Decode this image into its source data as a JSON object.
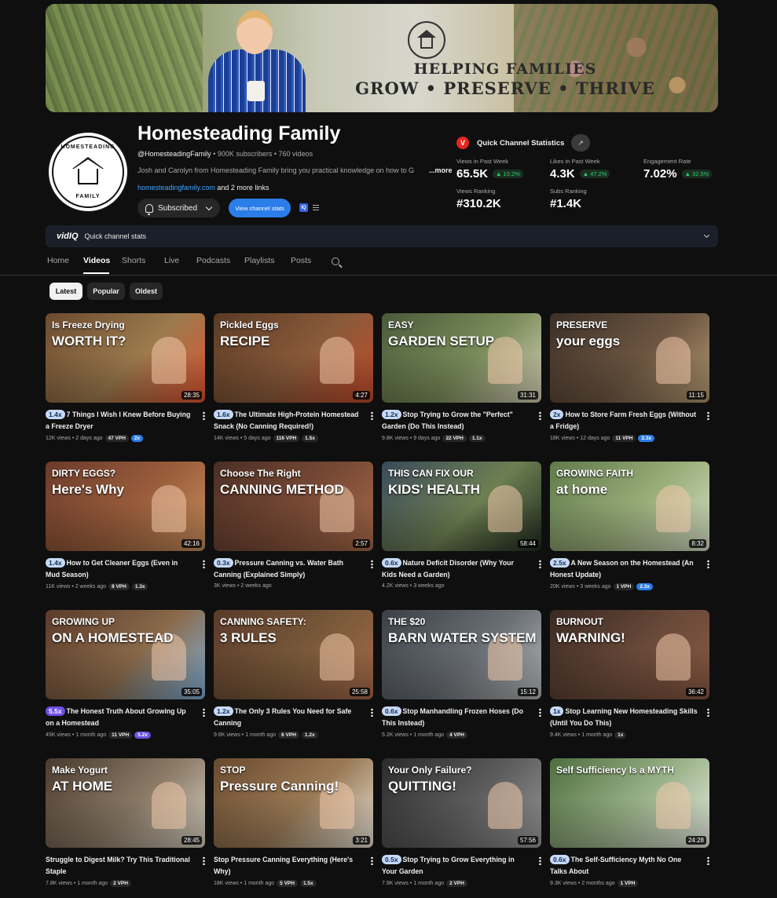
{
  "banner": {
    "tagline_line1": "HELPING FAMILIES",
    "tagline_line2": "GROW • PRESERVE • THRIVE"
  },
  "channel": {
    "name": "Homesteading Family",
    "handle": "@HomesteadingFamily",
    "subscribers": "• 900K subscribers",
    "videos": "• 760 videos",
    "description": "Josh and Carolyn from Homesteading Family bring you practical knowledge on how to G",
    "more_label": "...more",
    "link": "homesteadingfamily.com",
    "more_links": "and 2 more links",
    "subscribed_label": "Subscribed",
    "view_stats_label": "View channel stats",
    "avatar_top": "HOMESTEADING",
    "avatar_bottom": "FAMILY"
  },
  "stats": {
    "title": "Quick Channel Statistics",
    "logo": "V",
    "views_week_label": "Views in Past Week",
    "views_week_value": "65.5K",
    "views_week_change": "▲ 10.2%",
    "likes_week_label": "Likes in Past Week",
    "likes_week_value": "4.3K",
    "likes_week_change": "▲ 47.2%",
    "engagement_label": "Engagement Rate",
    "engagement_value": "7.02%",
    "engagement_change": "▲ 32.5%",
    "views_rank_label": "Views Ranking",
    "views_rank_value": "#310.2K",
    "subs_rank_label": "Subs Ranking",
    "subs_rank_value": "#1.4K"
  },
  "vidiq": {
    "logo": "vidIQ",
    "label": "Quick channel stats",
    "badge": "IQ"
  },
  "tabs": [
    "Home",
    "Videos",
    "Shorts",
    "Live",
    "Podcasts",
    "Playlists",
    "Posts"
  ],
  "chips": [
    "Latest",
    "Popular",
    "Oldest"
  ],
  "videos": [
    {
      "mult": "1.4x",
      "title": "7 Things I Wish I Knew Before Buying a Freeze Dryer",
      "meta": "12K views • 2 days ago",
      "vph": "47 VPH",
      "x": "2x",
      "dur": "28:35",
      "o1": "Is Freeze Drying",
      "o2": "WORTH IT?"
    },
    {
      "mult": "1.6x",
      "title": "The Ultimate High-Protein Homestead Snack (No Canning Required!)",
      "meta": "14K views • 5 days ago",
      "vph": "116 VPH",
      "x": "1.5x",
      "dur": "4:27",
      "o1": "Pickled Eggs",
      "o2": "RECIPE"
    },
    {
      "mult": "1.2x",
      "title": "Stop Trying to Grow the \"Perfect\" Garden (Do This Instead)",
      "meta": "9.8K views • 9 days ago",
      "vph": "22 VPH",
      "x": "1.1x",
      "dur": "31:31",
      "o1": "EASY",
      "o2": "GARDEN SETUP"
    },
    {
      "mult": "2x",
      "title": "How to Store Farm Fresh Eggs (Without a Fridge)",
      "meta": "18K views • 12 days ago",
      "vph": "11 VPH",
      "x": "2.3x",
      "dur": "11:15",
      "o1": "PRESERVE",
      "o2": "your eggs"
    },
    {
      "mult": "1.4x",
      "title": "How to Get Cleaner Eggs (Even in Mud Season)",
      "meta": "11K views • 2 weeks ago",
      "vph": "8 VPH",
      "x": "1.3x",
      "dur": "42:16",
      "o1": "DIRTY EGGS?",
      "o2": "Here's Why"
    },
    {
      "mult": "0.3x",
      "title": "Pressure Canning vs. Water Bath Canning (Explained Simply)",
      "meta": "3K views • 2 weeks ago",
      "vph": "",
      "x": "",
      "dur": "2:57",
      "o1": "Choose The Right",
      "o2": "CANNING METHOD"
    },
    {
      "mult": "0.6x",
      "title": "Nature Deficit Disorder (Why Your Kids Need a Garden)",
      "meta": "4.2K views • 3 weeks ago",
      "vph": "",
      "x": "",
      "dur": "58:44",
      "o1": "THIS CAN FIX OUR",
      "o2": "KIDS' HEALTH"
    },
    {
      "mult": "2.5x",
      "title": "A New Season on the Homestead (An Honest Update)",
      "meta": "20K views • 3 weeks ago",
      "vph": "1 VPH",
      "x": "2.3x",
      "dur": "8:32",
      "o1": "GROWING FAITH",
      "o2": "at home"
    },
    {
      "mult": "5.5x",
      "title": "The Honest Truth About Growing Up on a Homestead",
      "meta": "45K views • 1 month ago",
      "vph": "11 VPH",
      "x": "5.2x",
      "dur": "35:05",
      "o1": "GROWING UP",
      "o2": "ON A HOMESTEAD"
    },
    {
      "mult": "1.2x",
      "title": "The Only 3 Rules You Need for Safe Canning",
      "meta": "9.6K views • 1 month ago",
      "vph": "6 VPH",
      "x": "1.2x",
      "dur": "25:58",
      "o1": "CANNING SAFETY:",
      "o2": "3 RULES"
    },
    {
      "mult": "0.6x",
      "title": "Stop Manhandling Frozen Hoses (Do This Instead)",
      "meta": "5.2K views • 1 month ago",
      "vph": "4 VPH",
      "x": "",
      "dur": "15:12",
      "o1": "THE $20",
      "o2": "BARN WATER SYSTEM"
    },
    {
      "mult": "1x",
      "title": "Stop Learning New Homesteading Skills (Until You Do This)",
      "meta": "9.4K views • 1 month ago",
      "vph": "",
      "x": "1x",
      "dur": "36:42",
      "o1": "BURNOUT",
      "o2": "WARNING!"
    },
    {
      "mult": "",
      "title": "Struggle to Digest Milk? Try This Traditional Staple",
      "meta": "7.8K views • 1 month ago",
      "vph": "2 VPH",
      "x": "",
      "dur": "28:45",
      "o1": "Make Yogurt",
      "o2": "AT HOME"
    },
    {
      "mult": "",
      "title": "Stop Pressure Canning Everything (Here's Why)",
      "meta": "18K views • 1 month ago",
      "vph": "5 VPH",
      "x": "1.5x",
      "dur": "3:21",
      "o1": "STOP",
      "o2": "Pressure Canning!"
    },
    {
      "mult": "0.5x",
      "title": "Stop Trying to Grow Everything in Your Garden",
      "meta": "7.9K views • 1 month ago",
      "vph": "2 VPH",
      "x": "",
      "dur": "57:56",
      "o1": "Your Only Failure?",
      "o2": "QUITTING!"
    },
    {
      "mult": "0.6x",
      "title": "The Self-Sufficiency Myth No One Talks About",
      "meta": "9.3K views • 2 months ago",
      "vph": "1 VPH",
      "x": "",
      "dur": "24:28",
      "o1": "Self Sufficiency Is a MYTH",
      "o2": ""
    }
  ]
}
